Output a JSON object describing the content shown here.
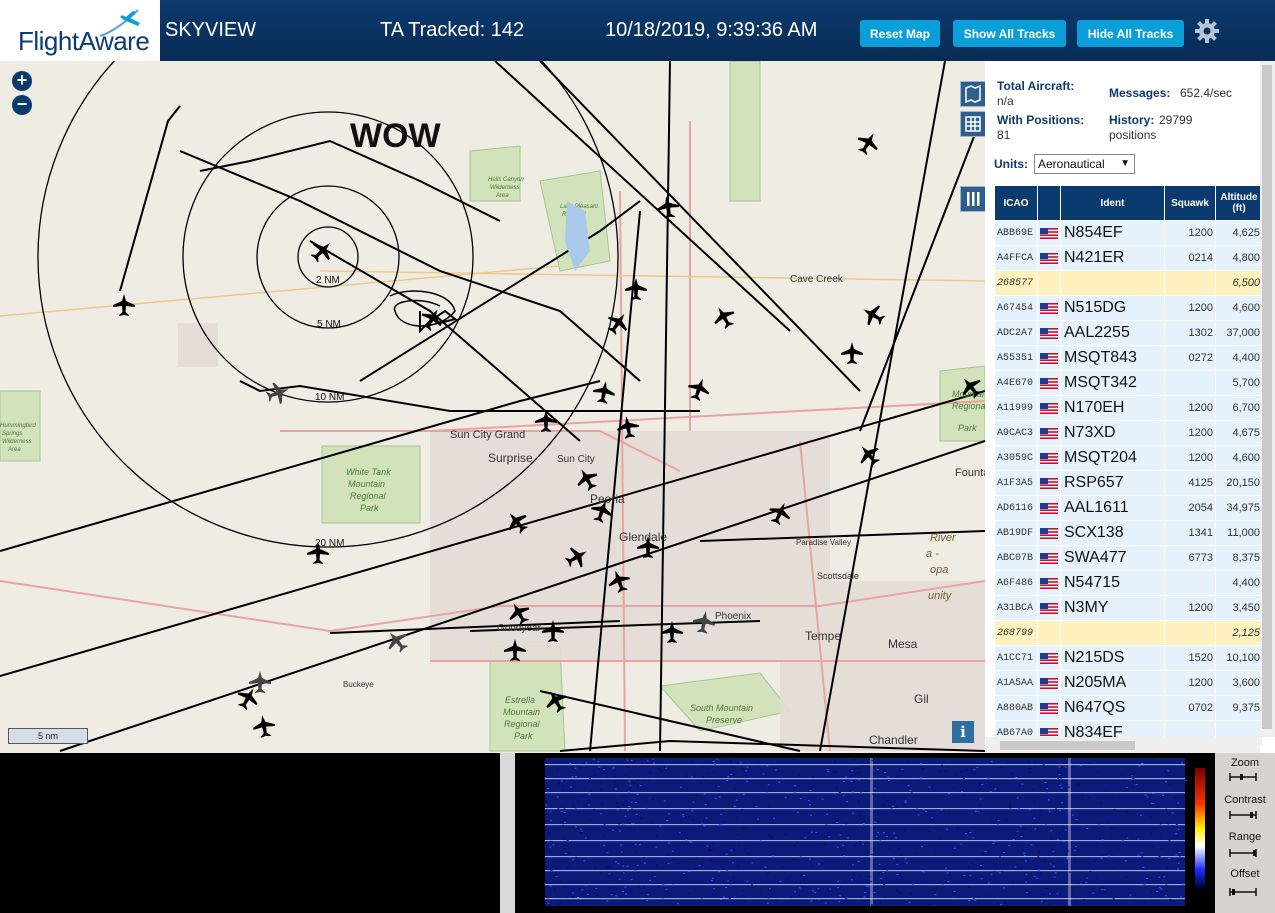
{
  "header": {
    "logo_text": "FlightAware",
    "app_name": "SKYVIEW",
    "tracked": "TA Tracked: 142",
    "datetime": "10/18/2019, 9:39:36 AM",
    "buttons": {
      "reset_map": "Reset Map",
      "show_all": "Show All Tracks",
      "hide_all": "Hide All Tracks"
    },
    "settings_icon": "gear-icon"
  },
  "map": {
    "overlay_text": "WOW",
    "range_rings": [
      "2 NM",
      "5 NM",
      "10 NM",
      "20 NM"
    ],
    "places": [
      "Cave Creek",
      "Sun City Grand",
      "Surprise",
      "Sun City",
      "Peoria",
      "Glendale",
      "Scottsdale",
      "Phoenix",
      "Tempe",
      "Mesa",
      "Goodyear",
      "Buckeye",
      "Gilbert",
      "Chandler",
      "Fountain",
      "White Tank Mountain Regional Park",
      "Estrella Mountain Regional Park",
      "South Mountain Preserve",
      "Paradise Valley",
      "Maricopa",
      "Hummingbird Springs Wilderness Area",
      "McDowell Mountain Regional Park",
      "Lake Pleasant Regional Park",
      "Hells Canyon Wilderness Area"
    ],
    "zoom_in": "+",
    "zoom_out": "−",
    "scale": "5 nm",
    "info": "i",
    "colors": {
      "background": "#efece4",
      "park": "#cfe3b8",
      "road": "#e8a3a3",
      "track": "#000000"
    }
  },
  "panel": {
    "total_aircraft_label": "Total Aircraft:",
    "total_aircraft_value": "n/a",
    "messages_label": "Messages:",
    "messages_value": "652.4/sec",
    "with_positions_label": "With Positions:",
    "with_positions_value": "81",
    "history_label": "History:",
    "history_value": "29799",
    "history_unit": "positions",
    "units_label": "Units:",
    "units_value": "Aeronautical",
    "columns": [
      "ICAO",
      "",
      "Ident",
      "Squawk",
      "Altitude (ft)"
    ],
    "rows": [
      {
        "icao": "ABB69E",
        "ident": "N854EF",
        "squawk": "1200",
        "alt": "4,625",
        "nopos": false
      },
      {
        "icao": "A4FFCA",
        "ident": "N421ER",
        "squawk": "0214",
        "alt": "4,800",
        "nopos": false
      },
      {
        "icao": "268577",
        "ident": "",
        "squawk": "",
        "alt": "6,500",
        "nopos": true
      },
      {
        "icao": "A67454",
        "ident": "N515DG",
        "squawk": "1200",
        "alt": "4,600",
        "nopos": false
      },
      {
        "icao": "ADC2A7",
        "ident": "AAL2255",
        "squawk": "1302",
        "alt": "37,000",
        "nopos": false
      },
      {
        "icao": "A55351",
        "ident": "MSQT843",
        "squawk": "0272",
        "alt": "4,400",
        "nopos": false
      },
      {
        "icao": "A4E670",
        "ident": "MSQT342",
        "squawk": "",
        "alt": "5,700",
        "nopos": false
      },
      {
        "icao": "A11999",
        "ident": "N170EH",
        "squawk": "1200",
        "alt": "6,700",
        "nopos": false
      },
      {
        "icao": "A9CAC3",
        "ident": "N73XD",
        "squawk": "1200",
        "alt": "4,675",
        "nopos": false
      },
      {
        "icao": "A3059C",
        "ident": "MSQT204",
        "squawk": "1200",
        "alt": "4,600",
        "nopos": false
      },
      {
        "icao": "A1F3A5",
        "ident": "RSP657",
        "squawk": "4125",
        "alt": "20,150",
        "nopos": false
      },
      {
        "icao": "AD6116",
        "ident": "AAL1611",
        "squawk": "2054",
        "alt": "34,975",
        "nopos": false
      },
      {
        "icao": "AB19DF",
        "ident": "SCX138",
        "squawk": "1341",
        "alt": "11,000",
        "nopos": false
      },
      {
        "icao": "ABC07B",
        "ident": "SWA477",
        "squawk": "6773",
        "alt": "8,375",
        "nopos": false
      },
      {
        "icao": "A6F486",
        "ident": "N54715",
        "squawk": "",
        "alt": "4,400",
        "nopos": false
      },
      {
        "icao": "A31BCA",
        "ident": "N3MY",
        "squawk": "1200",
        "alt": "3,450",
        "nopos": false
      },
      {
        "icao": "268799",
        "ident": "",
        "squawk": "",
        "alt": "2,125",
        "nopos": true
      },
      {
        "icao": "A1CC71",
        "ident": "N215DS",
        "squawk": "1520",
        "alt": "10,100",
        "nopos": false
      },
      {
        "icao": "A1A5AA",
        "ident": "N205MA",
        "squawk": "1200",
        "alt": "3,600",
        "nopos": false
      },
      {
        "icao": "A880AB",
        "ident": "N647QS",
        "squawk": "0702",
        "alt": "9,375",
        "nopos": false
      },
      {
        "icao": "AB67A0",
        "ident": "N834EF",
        "squawk": "",
        "alt": "",
        "nopos": false
      }
    ]
  },
  "spectrum": {
    "controls": [
      "Zoom",
      "Contrast",
      "Range",
      "Offset"
    ]
  }
}
